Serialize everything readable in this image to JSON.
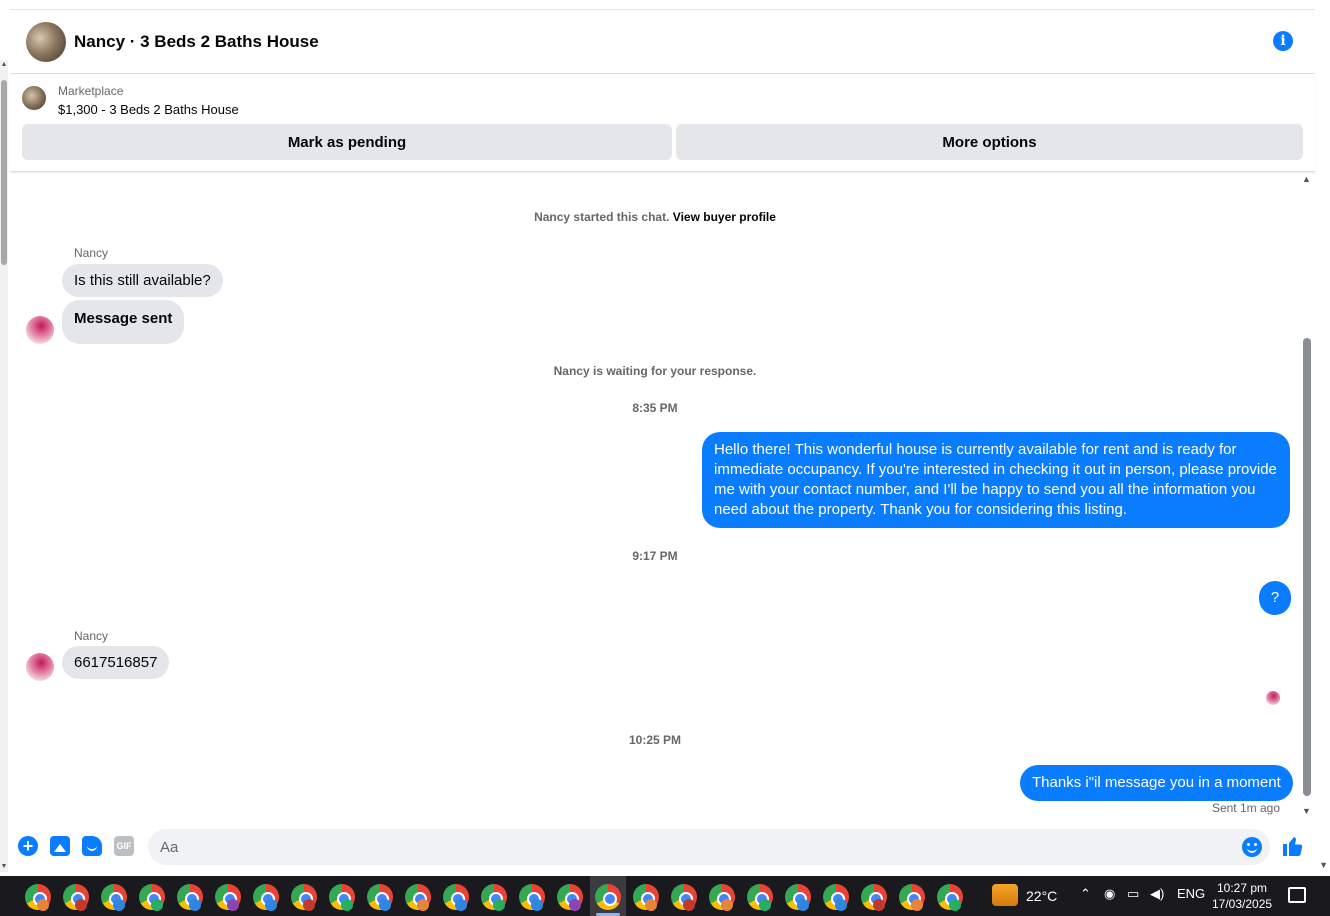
{
  "header": {
    "title": "Nancy · 3 Beds 2 Baths House"
  },
  "marketplace": {
    "label": "Marketplace",
    "listing": "$1,300 - 3 Beds 2 Baths House",
    "mark_pending": "Mark as pending",
    "more_options": "More options"
  },
  "chat": {
    "started_prefix": "Nancy started this chat.",
    "view_profile": "View buyer profile",
    "sender_name_1": "Nancy",
    "msg_in_1": "Is this still available?",
    "msg_in_2": "Message sent",
    "waiting": "Nancy is waiting for your response.",
    "time_1": "8:35 PM",
    "msg_out_1": "Hello there! This wonderful house is currently available for rent and is ready for immediate occupancy. If you're interested in checking it out in person, please provide me with your contact number, and I'll be happy to send you all the information you need about the property. Thank you for considering this listing.",
    "time_2": "9:17 PM",
    "msg_out_2": "?",
    "sender_name_2": "Nancy",
    "msg_in_3": "6617516857",
    "time_3": "10:25 PM",
    "msg_out_3": "Thanks i\"il message you in a moment",
    "sent_status": "Sent 1m ago"
  },
  "composer": {
    "placeholder": "Aa",
    "gif_label": "GIF"
  },
  "taskbar": {
    "weather": "22°C",
    "language": "ENG",
    "time": "10:27 pm",
    "date": "17/03/2025"
  },
  "colors": {
    "accent": "#0a7cff",
    "bubble_in": "#e4e6eb",
    "taskbar": "#1a1a1e"
  },
  "icons": [
    "info-icon",
    "plus-icon",
    "image-icon",
    "sticker-icon",
    "gif-icon",
    "emoji-icon",
    "like-icon",
    "chrome-icon",
    "weather-icon",
    "chevron-up-icon",
    "network-icon",
    "volume-icon",
    "notification-icon"
  ]
}
